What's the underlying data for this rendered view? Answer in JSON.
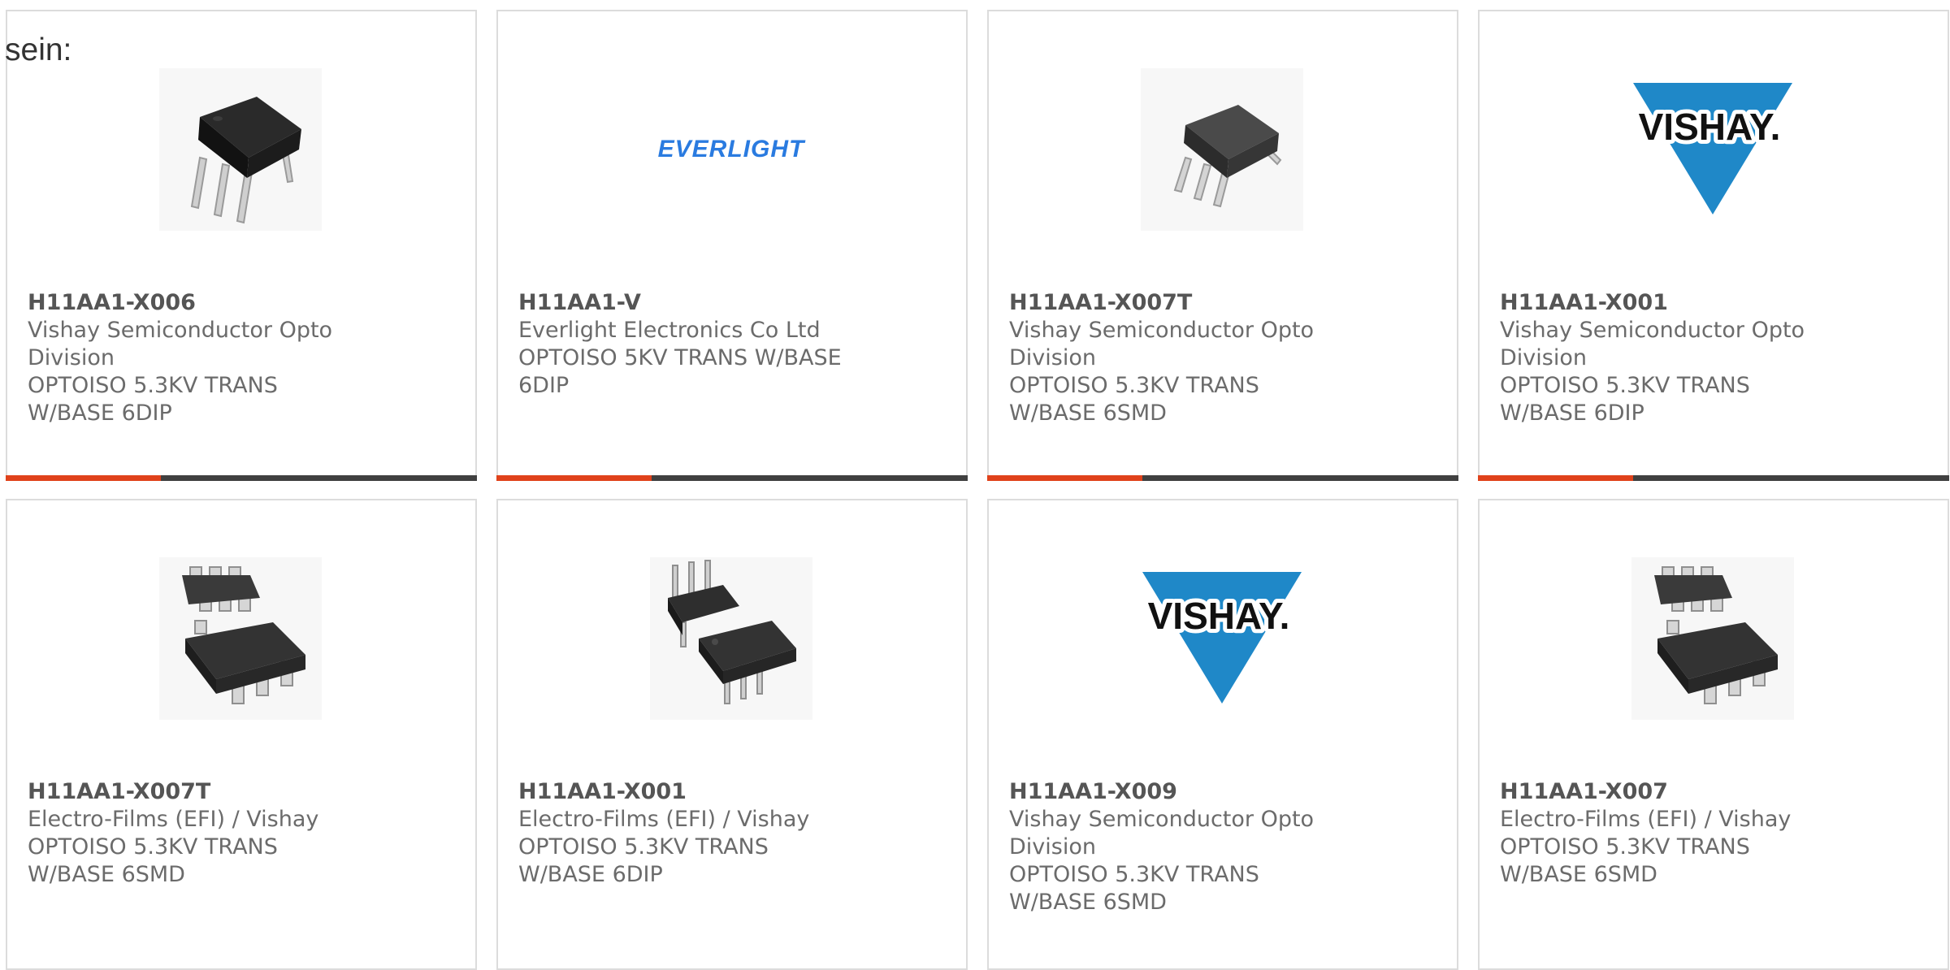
{
  "heading": "sein:",
  "colors": {
    "accent": "#e0421b",
    "bar": "#404040",
    "vishay_blue": "#1f88c8",
    "everlight_blue": "#2a7be0"
  },
  "cards": [
    {
      "part_number": "H11AA1-X006",
      "manufacturer": "Vishay Semiconductor Opto Division",
      "description": "OPTOISO 5.3KV TRANS W/BASE 6DIP",
      "image": "dip-chip-angled",
      "progress": 0.33
    },
    {
      "part_number": "H11AA1-V",
      "manufacturer": "Everlight Electronics Co Ltd",
      "description": "OPTOISO 5KV TRANS W/BASE 6DIP",
      "image": "everlight-logo",
      "logo_text": "EVERLIGHT",
      "progress": 0.33
    },
    {
      "part_number": "H11AA1-X007T",
      "manufacturer": "Vishay Semiconductor Opto Division",
      "description": "OPTOISO 5.3KV TRANS W/BASE 6SMD",
      "image": "smd-chip-angled",
      "progress": 0.33
    },
    {
      "part_number": "H11AA1-X001",
      "manufacturer": "Vishay Semiconductor Opto Division",
      "description": "OPTOISO 5.3KV TRANS W/BASE 6DIP",
      "image": "vishay-logo",
      "logo_text": "VISHAY.",
      "progress": 0.33
    },
    {
      "part_number": "H11AA1-X007T",
      "manufacturer": "Electro-Films (EFI) / Vishay",
      "description": "OPTOISO 5.3KV TRANS W/BASE 6SMD",
      "image": "smd-chip-pair",
      "progress": 0.33
    },
    {
      "part_number": "H11AA1-X001",
      "manufacturer": "Electro-Films (EFI) / Vishay",
      "description": "OPTOISO 5.3KV TRANS W/BASE 6DIP",
      "image": "dip-chip-pair",
      "progress": 0.33
    },
    {
      "part_number": "H11AA1-X009",
      "manufacturer": "Vishay Semiconductor Opto Division",
      "description": "OPTOISO 5.3KV TRANS W/BASE 6SMD",
      "image": "vishay-logo",
      "logo_text": "VISHAY.",
      "progress": 0.33
    },
    {
      "part_number": "H11AA1-X007",
      "manufacturer": "Electro-Films (EFI) / Vishay",
      "description": "OPTOISO 5.3KV TRANS W/BASE 6SMD",
      "image": "smd-chip-pair",
      "progress": 0.33
    }
  ]
}
